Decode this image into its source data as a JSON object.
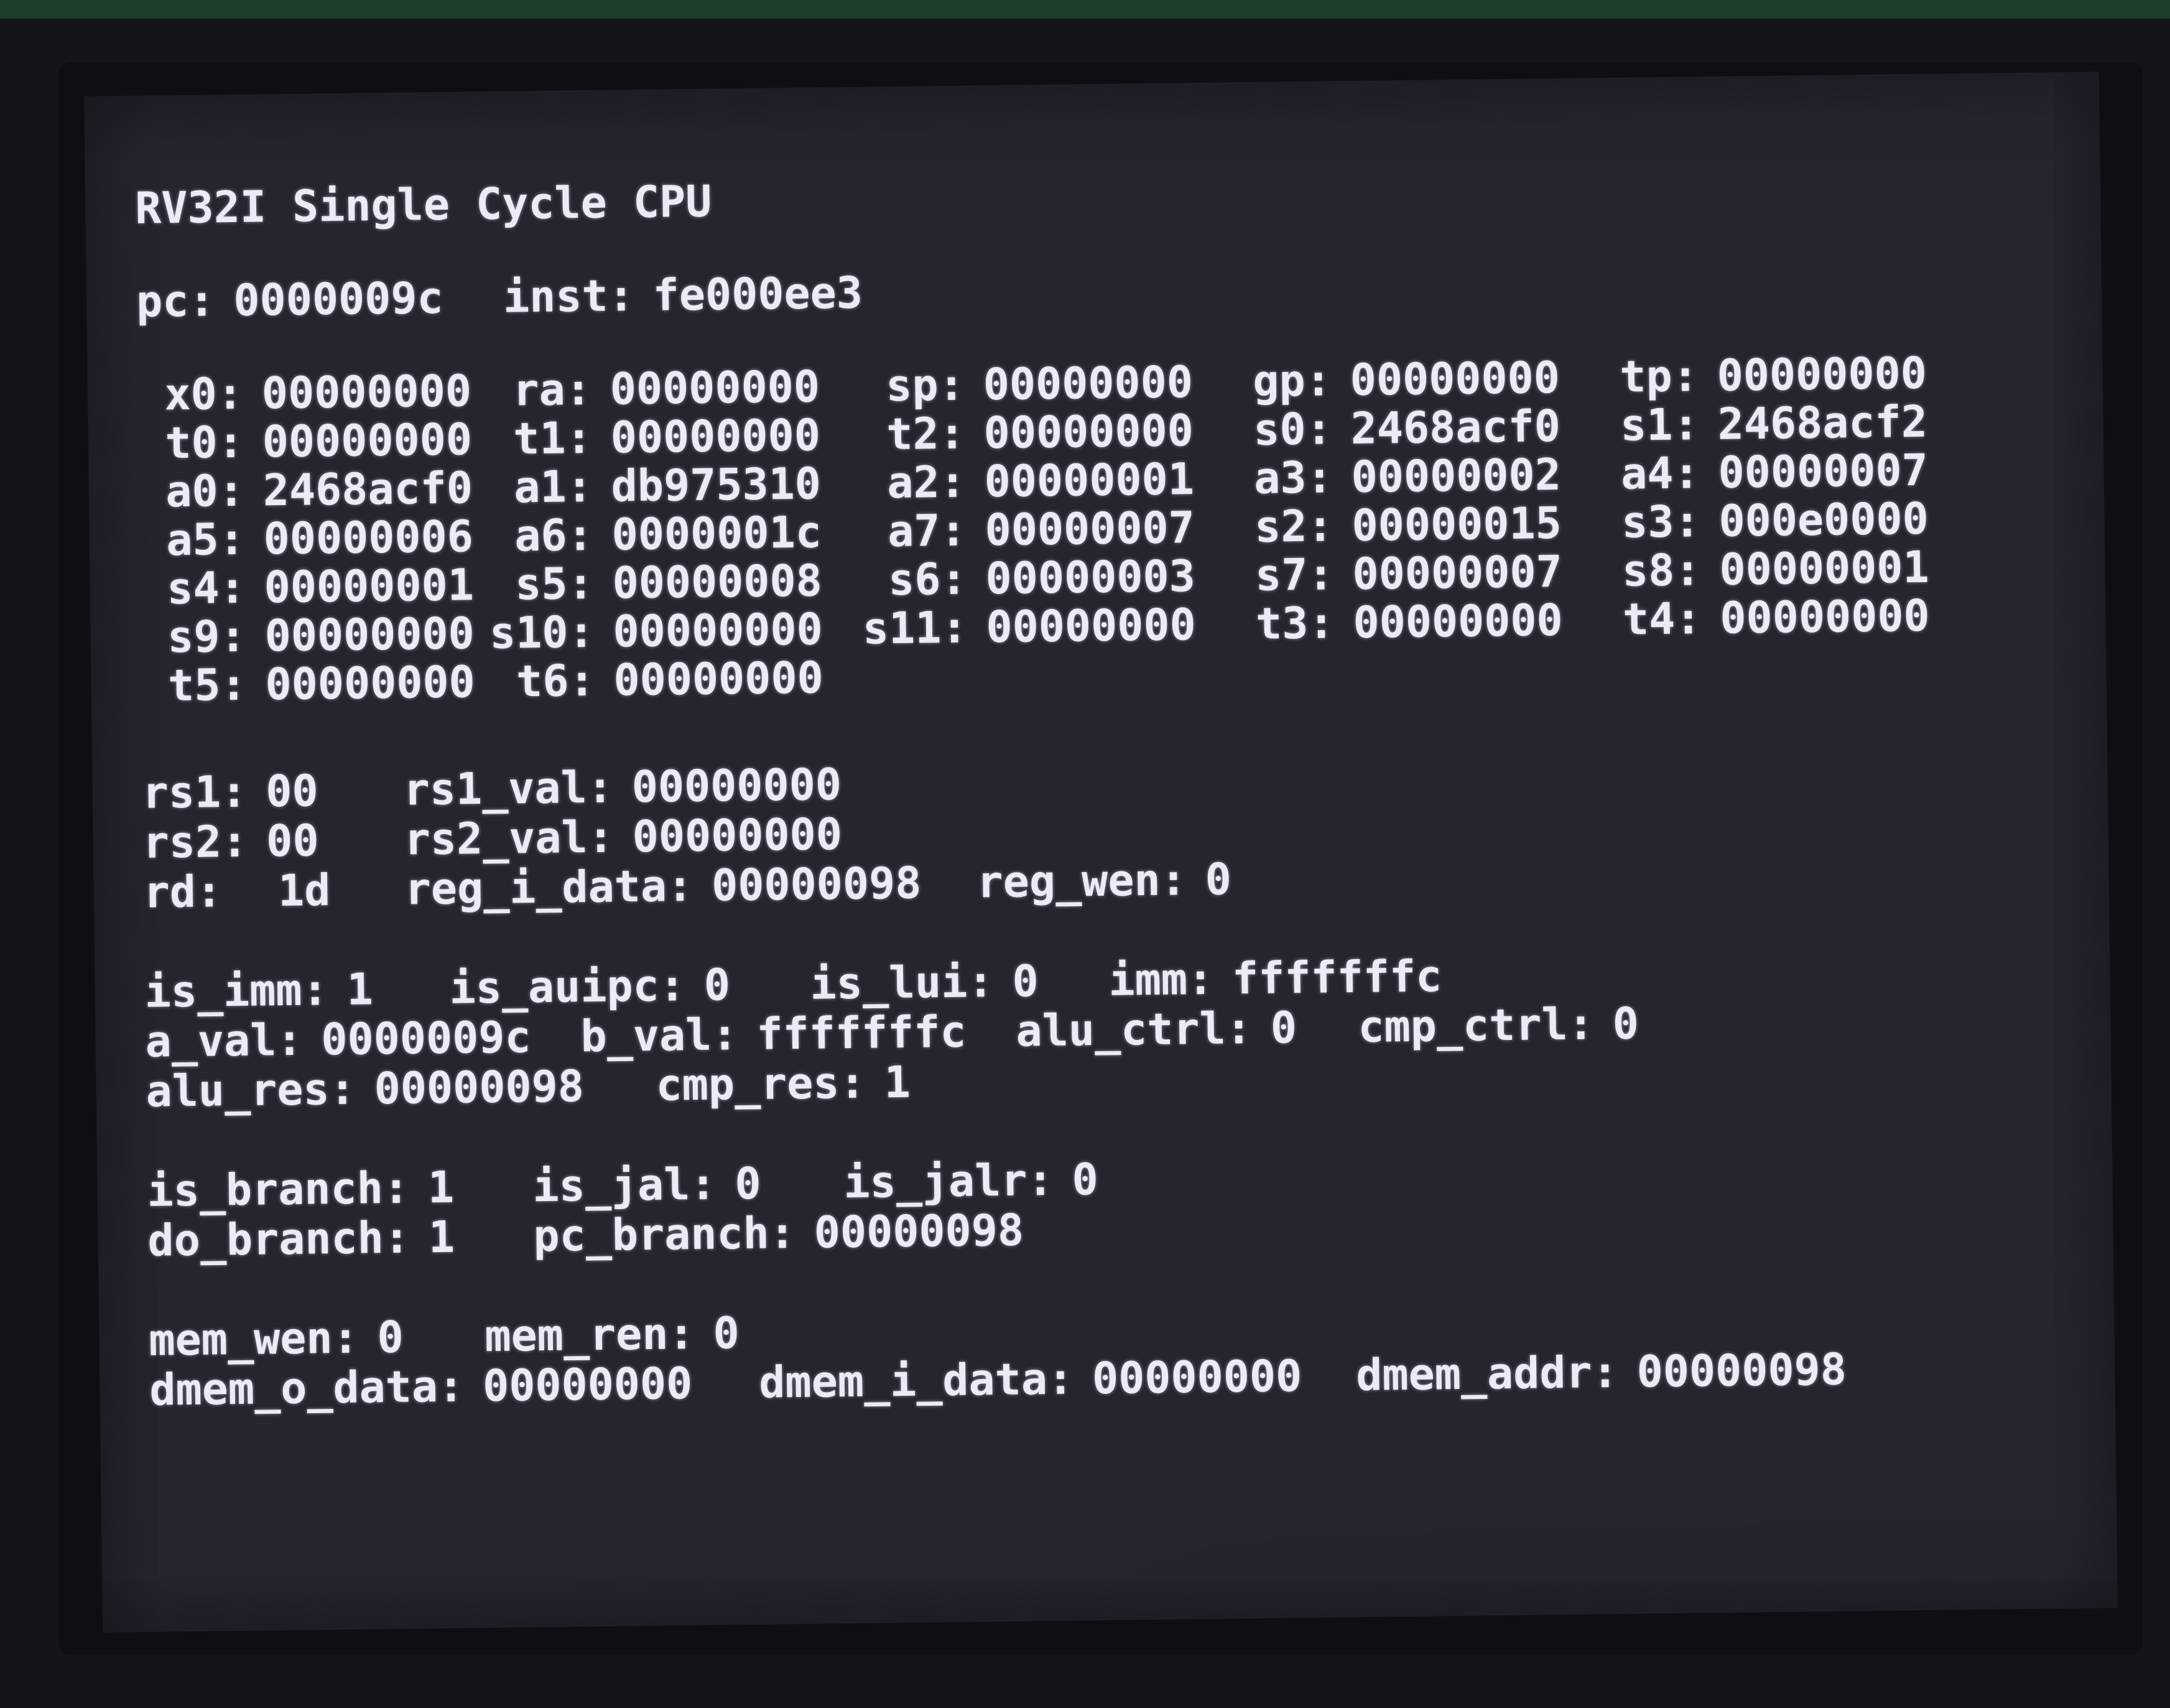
{
  "title": "RV32I Single Cycle CPU",
  "pc": {
    "label": "pc:",
    "value": "0000009c"
  },
  "inst": {
    "label": "inst:",
    "value": "fe000ee3"
  },
  "registers": [
    [
      {
        "name": "x0:",
        "value": "00000000"
      },
      {
        "name": "ra:",
        "value": "00000000"
      },
      {
        "name": "sp:",
        "value": "00000000"
      },
      {
        "name": "gp:",
        "value": "00000000"
      },
      {
        "name": "tp:",
        "value": "00000000"
      }
    ],
    [
      {
        "name": "t0:",
        "value": "00000000"
      },
      {
        "name": "t1:",
        "value": "00000000"
      },
      {
        "name": "t2:",
        "value": "00000000"
      },
      {
        "name": "s0:",
        "value": "2468acf0"
      },
      {
        "name": "s1:",
        "value": "2468acf2"
      }
    ],
    [
      {
        "name": "a0:",
        "value": "2468acf0"
      },
      {
        "name": "a1:",
        "value": "db975310"
      },
      {
        "name": "a2:",
        "value": "00000001"
      },
      {
        "name": "a3:",
        "value": "00000002"
      },
      {
        "name": "a4:",
        "value": "00000007"
      }
    ],
    [
      {
        "name": "a5:",
        "value": "00000006"
      },
      {
        "name": "a6:",
        "value": "0000001c"
      },
      {
        "name": "a7:",
        "value": "00000007"
      },
      {
        "name": "s2:",
        "value": "00000015"
      },
      {
        "name": "s3:",
        "value": "000e0000"
      }
    ],
    [
      {
        "name": "s4:",
        "value": "00000001"
      },
      {
        "name": "s5:",
        "value": "00000008"
      },
      {
        "name": "s6:",
        "value": "00000003"
      },
      {
        "name": "s7:",
        "value": "00000007"
      },
      {
        "name": "s8:",
        "value": "00000001"
      }
    ],
    [
      {
        "name": "s9:",
        "value": "00000000"
      },
      {
        "name": "s10:",
        "value": "00000000"
      },
      {
        "name": "s11:",
        "value": "00000000"
      },
      {
        "name": "t3:",
        "value": "00000000"
      },
      {
        "name": "t4:",
        "value": "00000000"
      }
    ],
    [
      {
        "name": "t5:",
        "value": "00000000"
      },
      {
        "name": "t6:",
        "value": "00000000"
      }
    ]
  ],
  "rs1": {
    "label": "rs1:",
    "value": "00",
    "val_label": "rs1_val:",
    "val": "00000000"
  },
  "rs2": {
    "label": "rs2:",
    "value": "00",
    "val_label": "rs2_val:",
    "val": "00000000"
  },
  "rd": {
    "label": "rd:",
    "value": "1d",
    "data_label": "reg_i_data:",
    "data": "00000098",
    "wen_label": "reg_wen:",
    "wen": "0"
  },
  "decode": {
    "is_imm": {
      "label": "is_imm:",
      "value": "1"
    },
    "is_auipc": {
      "label": "is_auipc:",
      "value": "0"
    },
    "is_lui": {
      "label": "is_lui:",
      "value": "0"
    },
    "imm": {
      "label": "imm:",
      "value": "fffffffc"
    }
  },
  "alu": {
    "a_val": {
      "label": "a_val:",
      "value": "0000009c"
    },
    "b_val": {
      "label": "b_val:",
      "value": "fffffffc"
    },
    "alu_ctrl": {
      "label": "alu_ctrl:",
      "value": "0"
    },
    "cmp_ctrl": {
      "label": "cmp_ctrl:",
      "value": "0"
    },
    "alu_res": {
      "label": "alu_res:",
      "value": "00000098"
    },
    "cmp_res": {
      "label": "cmp_res:",
      "value": "1"
    }
  },
  "branch": {
    "is_branch": {
      "label": "is_branch:",
      "value": "1"
    },
    "is_jal": {
      "label": "is_jal:",
      "value": "0"
    },
    "is_jalr": {
      "label": "is_jalr:",
      "value": "0"
    },
    "do_branch": {
      "label": "do_branch:",
      "value": "1"
    },
    "pc_branch": {
      "label": "pc_branch:",
      "value": "00000098"
    }
  },
  "memory": {
    "mem_wen": {
      "label": "mem_wen:",
      "value": "0"
    },
    "mem_ren": {
      "label": "mem_ren:",
      "value": "0"
    },
    "dmem_o_data": {
      "label": "dmem_o_data:",
      "value": "00000000"
    },
    "dmem_i_data": {
      "label": "dmem_i_data:",
      "value": "00000000"
    },
    "dmem_addr": {
      "label": "dmem_addr:",
      "value": "00000098"
    }
  }
}
